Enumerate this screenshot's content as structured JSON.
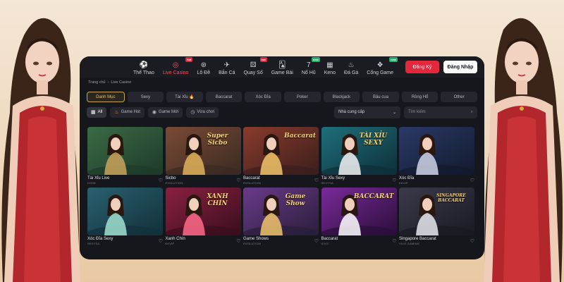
{
  "nav": {
    "items": [
      {
        "label": "Thể Thao",
        "icon": "soccer-ball-icon",
        "glyph": "⚽",
        "tag": ""
      },
      {
        "label": "Live Casino",
        "icon": "casino-chip-icon",
        "glyph": "◎",
        "tag": "hot",
        "active": true
      },
      {
        "label": "Lô Đề",
        "icon": "lottery-icon",
        "glyph": "⊛",
        "tag": ""
      },
      {
        "label": "Bắn Cá",
        "icon": "fish-icon",
        "glyph": "✈",
        "tag": ""
      },
      {
        "label": "Quay Số",
        "icon": "dice-icon",
        "glyph": "⚄",
        "tag": "hot"
      },
      {
        "label": "Game Bài",
        "icon": "cards-icon",
        "glyph": "🂡",
        "tag": ""
      },
      {
        "label": "Nổ Hũ",
        "icon": "slot-seven-icon",
        "glyph": "7",
        "tag": "new"
      },
      {
        "label": "Keno",
        "icon": "keno-grid-icon",
        "glyph": "▦",
        "tag": ""
      },
      {
        "label": "Đá Gà",
        "icon": "rooster-icon",
        "glyph": "♨",
        "tag": ""
      },
      {
        "label": "Cổng Game",
        "icon": "game-portal-icon",
        "glyph": "❖",
        "tag": "new"
      }
    ],
    "register_label": "Đăng Ký",
    "login_label": "Đăng Nhập"
  },
  "breadcrumb": {
    "home": "Trang chủ",
    "sep": "›",
    "current": "Live Casino"
  },
  "categories": [
    "Danh Mục",
    "Sexy",
    "Tài Xỉu 🔥",
    "Baccarat",
    "Xóc Đĩa",
    "Poker",
    "Blackjack",
    "Bầu cua",
    "Rồng Hổ",
    "Other"
  ],
  "filters": {
    "all": "All",
    "hot": "Game Hot",
    "new": "Game Mới",
    "played": "Vừa chơi",
    "provider_placeholder": "Nhà cung cấp",
    "search_placeholder": "Tìm kiếm"
  },
  "games": [
    {
      "title": "Tài Xỉu Live",
      "provider": "DOS8",
      "label": ""
    },
    {
      "title": "Sicbo",
      "provider": "EVOLUTION",
      "label": "Super Sicbo"
    },
    {
      "title": "Baccarat",
      "provider": "EVOLUTION",
      "label": "Baccarat"
    },
    {
      "title": "Tài Xỉu Sexy",
      "provider": "SEXYSA",
      "label": "TÀI XỈU SEXY"
    },
    {
      "title": "Xóc Đĩa",
      "provider": "KKVIP",
      "label": ""
    },
    {
      "title": "Xóc Đĩa Sexy",
      "provider": "SEXYSA",
      "label": ""
    },
    {
      "title": "Xanh Chín",
      "provider": "KKVIP",
      "label": "XANH CHÍN"
    },
    {
      "title": "Game Shows",
      "provider": "EVOLUTION",
      "label": "Game Show"
    },
    {
      "title": "Baccarat",
      "provider": "VIVO",
      "label": "BACCARAT"
    },
    {
      "title": "Singapore Baccarat",
      "provider": "VIVO GAMING",
      "label": "SINGAPORE BACCARAT"
    }
  ],
  "colors": {
    "accent": "#e3283b",
    "gold": "#c9a44b",
    "panel": "#16171c"
  }
}
